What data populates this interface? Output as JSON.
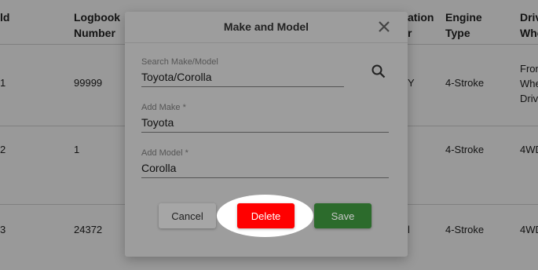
{
  "table": {
    "headers": [
      {
        "l1": "ld",
        "l2": ""
      },
      {
        "l1": "Logbook",
        "l2": "Number"
      },
      {
        "l1": "ation",
        "l2": "r"
      },
      {
        "l1": "Engine",
        "l2": "Type"
      },
      {
        "l1": "Drive",
        "l2": "Whe"
      }
    ],
    "rows": [
      {
        "id": "1",
        "logbook": "99999",
        "location": "Y",
        "engine": "4-Stroke",
        "drive_l1": "Fron",
        "drive_l2": "Whe",
        "drive_l3": "Drive"
      },
      {
        "id": "2",
        "logbook": "1",
        "location": "",
        "engine": "4-Stroke",
        "drive_l1": "4WD",
        "drive_l2": "",
        "drive_l3": ""
      },
      {
        "id": "3",
        "logbook": "24372",
        "location": "l",
        "engine": "4-Stroke",
        "drive_l1": "4WD",
        "drive_l2": "",
        "drive_l3": ""
      }
    ]
  },
  "dialog": {
    "title": "Make and Model",
    "close_icon": "close-icon",
    "search": {
      "label": "Search Make/Model",
      "value": "Toyota/Corolla",
      "icon": "search-icon"
    },
    "make": {
      "label": "Add Make *",
      "value": "Toyota"
    },
    "model": {
      "label": "Add Model *",
      "value": "Corolla"
    },
    "buttons": {
      "cancel": "Cancel",
      "delete": "Delete",
      "save": "Save"
    }
  },
  "colors": {
    "delete": "#ff0000",
    "save": "#2c6b2c",
    "overlay": "rgba(0,0,0,0.40)"
  }
}
